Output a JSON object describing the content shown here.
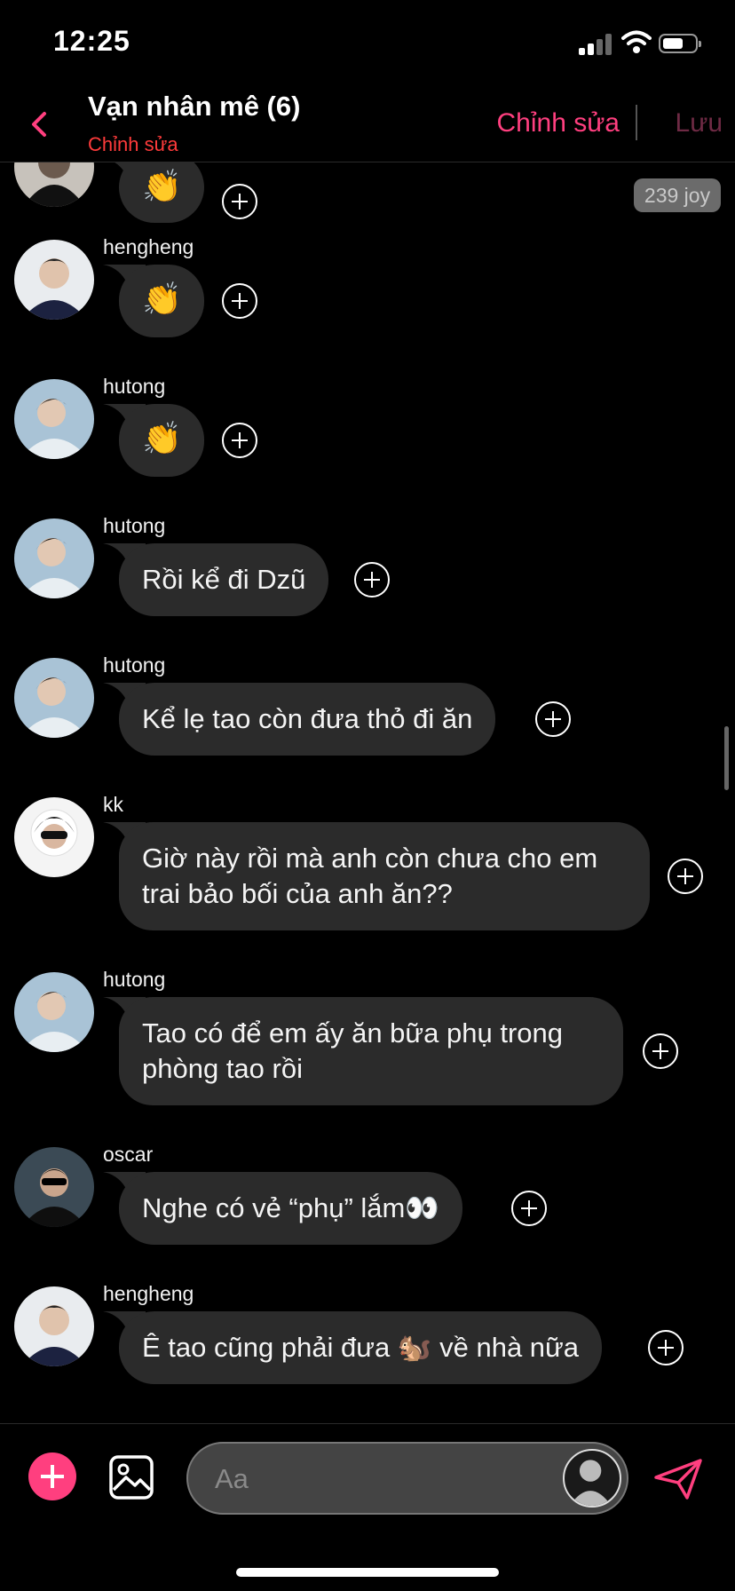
{
  "status_bar": {
    "time": "12:25"
  },
  "header": {
    "title": "Vạn nhân mê (6)",
    "subtitle": "Chỉnh sửa",
    "edit_label": "Chỉnh sửa",
    "save_label": "Lưu"
  },
  "joy_badge": "239 joy",
  "messages": [
    {
      "sender": "",
      "text": "👏",
      "avatar": "oscar"
    },
    {
      "sender": "hengheng",
      "text": "👏",
      "avatar": "hengheng"
    },
    {
      "sender": "hutong",
      "text": "👏",
      "avatar": "hutong"
    },
    {
      "sender": "hutong",
      "text": "Rồi kể đi Dzũ",
      "avatar": "hutong"
    },
    {
      "sender": "hutong",
      "text": "Kể lẹ tao còn đưa thỏ đi ăn",
      "avatar": "hutong"
    },
    {
      "sender": "kk",
      "line1": "Giờ này rồi mà anh còn chưa cho em",
      "line2": "trai bảo bối của anh ăn??",
      "avatar": "kk"
    },
    {
      "sender": "hutong",
      "line1": "Tao có để em ấy ăn bữa phụ trong",
      "line2": "phòng tao rồi",
      "avatar": "hutong"
    },
    {
      "sender": "oscar",
      "text": "Nghe có vẻ “phụ” lắm👀",
      "avatar": "oscar"
    },
    {
      "sender": "hengheng",
      "text": "Ê tao cũng phải đưa 🐿️ về nhà nữa",
      "avatar": "hengheng"
    }
  ],
  "composer": {
    "placeholder": "Aa"
  },
  "colors": {
    "accent": "#ff3f7f",
    "bubble": "#2b2b2b",
    "background": "#000000"
  },
  "icons": [
    "back-icon",
    "plus-circle-icon",
    "add-icon",
    "image-icon",
    "send-icon"
  ]
}
